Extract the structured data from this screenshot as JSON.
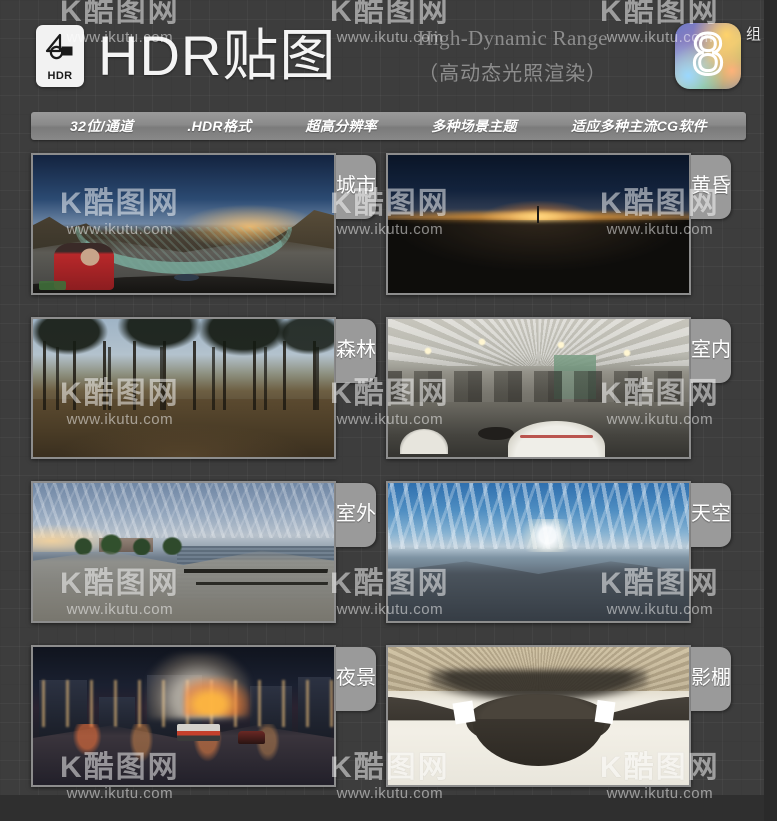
{
  "header": {
    "icon_label": "HDR",
    "icon_name": "hdr-file-icon",
    "title": "HDR贴图",
    "subtitle_en": "High-Dynamic Range",
    "subtitle_cn": "（高动态光照渲染）",
    "badge_number": "8",
    "badge_unit": "组"
  },
  "features": [
    "32位/通道",
    ".HDR格式",
    "超高分辨率",
    "多种场景主题",
    "适应多种主流CG软件"
  ],
  "watermark": {
    "logo": "K酷图网",
    "url": "www.ikutu.com"
  },
  "gallery": [
    {
      "label": "城市",
      "scene": "city-hillside-dusk-panorama"
    },
    {
      "label": "黄昏",
      "scene": "desert-sunset-panorama"
    },
    {
      "label": "森林",
      "scene": "forest-panorama"
    },
    {
      "label": "室内",
      "scene": "indoor-store-panorama"
    },
    {
      "label": "室外",
      "scene": "waterfront-road-panorama"
    },
    {
      "label": "天空",
      "scene": "sky-clouds-panorama"
    },
    {
      "label": "夜景",
      "scene": "night-city-street-panorama"
    },
    {
      "label": "影棚",
      "scene": "studio-softbox-panorama"
    }
  ],
  "colors": {
    "background": "#3d3d3d",
    "tab": "#9a9a9a",
    "feature_bar": "#8a8a8a",
    "title_text": "#f4f4f4",
    "subtitle_text": "#8d8d8d"
  }
}
